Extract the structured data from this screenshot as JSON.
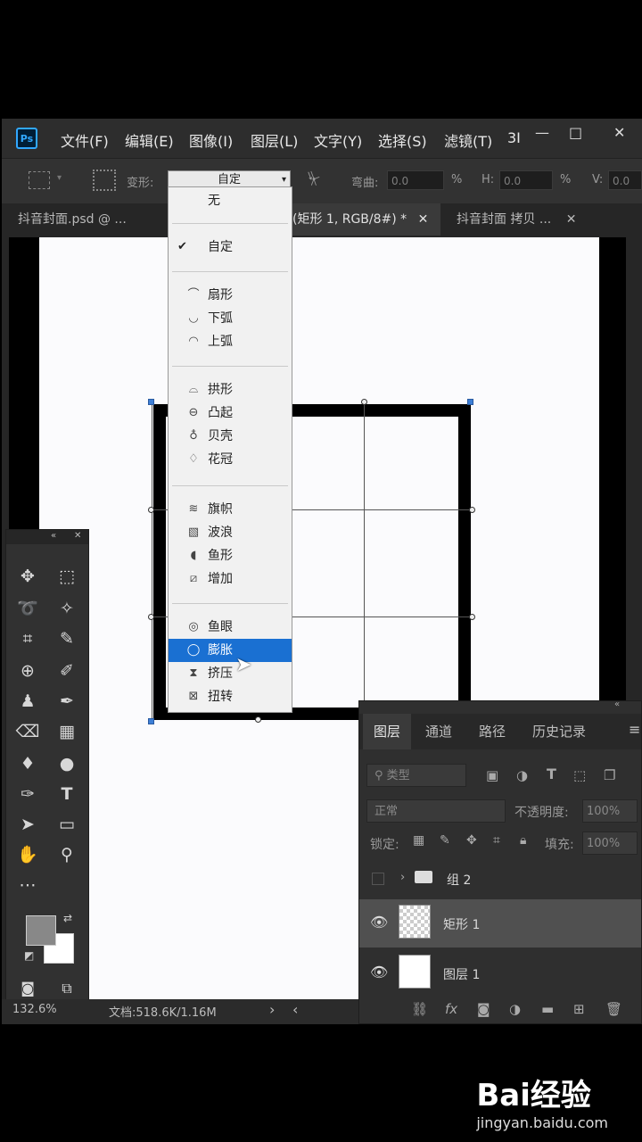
{
  "app": {
    "logo": "Ps"
  },
  "menubar": {
    "items": [
      "文件(F)",
      "编辑(E)",
      "图像(I)",
      "图层(L)",
      "文字(Y)",
      "选择(S)",
      "滤镜(T)",
      "3I"
    ]
  },
  "window_controls": {
    "minimize": "—",
    "maximize": "□",
    "close": "✕"
  },
  "options_bar": {
    "warp_label": "变形:",
    "warp_value": "自定",
    "bend_label": "弯曲:",
    "bend_value": "0.0",
    "percent": "%",
    "h_label": "H:",
    "h_value": "0.0",
    "v_label": "V:",
    "v_value": "0.0"
  },
  "tabs": [
    {
      "label": "抖音封面.psd @ ..."
    },
    {
      "label": "(矩形 1, RGB/8#) *"
    },
    {
      "label": "抖音封面 拷贝 ..."
    }
  ],
  "tab_close": "✕",
  "warp_menu": {
    "groups": [
      [
        {
          "label": "无",
          "icon": ""
        }
      ],
      [
        {
          "label": "自定",
          "icon": "",
          "checked": true
        }
      ],
      [
        {
          "label": "扇形",
          "icon": "arc-icon"
        },
        {
          "label": "下弧",
          "icon": "arc-lower-icon"
        },
        {
          "label": "上弧",
          "icon": "arc-upper-icon"
        }
      ],
      [
        {
          "label": "拱形",
          "icon": "arch-icon"
        },
        {
          "label": "凸起",
          "icon": "bulge-icon"
        },
        {
          "label": "贝壳",
          "icon": "shell-icon"
        },
        {
          "label": "花冠",
          "icon": "flower-icon"
        }
      ],
      [
        {
          "label": "旗帜",
          "icon": "flag-icon"
        },
        {
          "label": "波浪",
          "icon": "wave-icon"
        },
        {
          "label": "鱼形",
          "icon": "fish-icon"
        },
        {
          "label": "增加",
          "icon": "rise-icon"
        }
      ],
      [
        {
          "label": "鱼眼",
          "icon": "fisheye-icon"
        },
        {
          "label": "膨胀",
          "icon": "inflate-icon",
          "selected": true
        },
        {
          "label": "挤压",
          "icon": "squeeze-icon"
        },
        {
          "label": "扭转",
          "icon": "twist-icon"
        }
      ]
    ],
    "checkmark": "✔"
  },
  "status": {
    "zoom": "132.6%",
    "doc": "文档:518.6K/1.16M",
    "arrow_right": "›",
    "arrow_left": "‹"
  },
  "layers_panel": {
    "tabs": [
      "图层",
      "通道",
      "路径",
      "历史记录"
    ],
    "menu_icon": "≡",
    "filter_label": "类型",
    "blend_mode": "正常",
    "opacity_label": "不透明度:",
    "opacity_value": "100%",
    "lock_label": "锁定:",
    "fill_label": "填充:",
    "fill_value": "100%",
    "layers": [
      {
        "name": "组 2",
        "type": "group",
        "visible": false
      },
      {
        "name": "矩形 1",
        "type": "shape",
        "visible": true,
        "selected": true
      },
      {
        "name": "图层 1",
        "type": "pixel",
        "visible": true
      }
    ]
  },
  "watermark": {
    "logo": "Bai经验",
    "url": "jingyan.baidu.com"
  }
}
